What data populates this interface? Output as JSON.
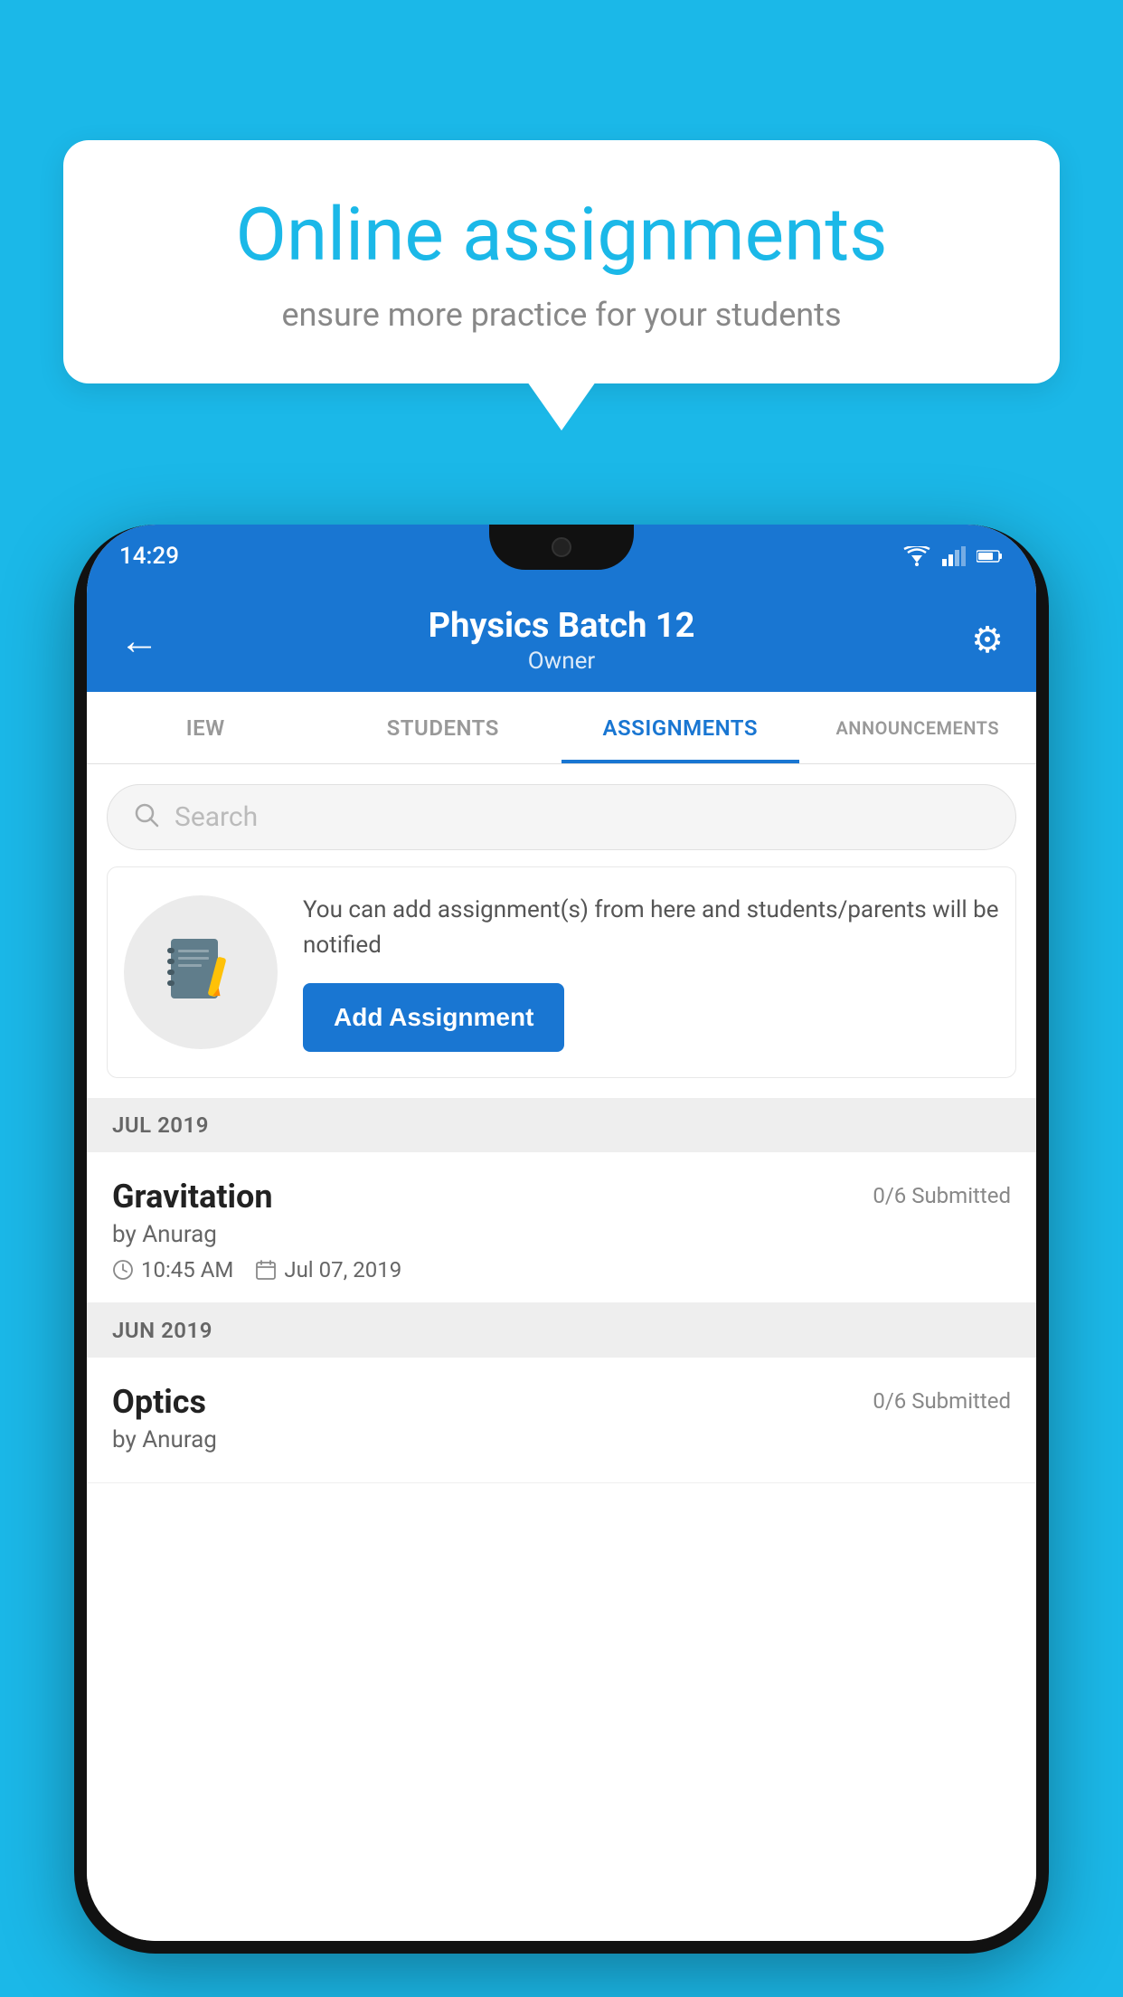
{
  "background_color": "#1BB8E8",
  "speech_bubble": {
    "title": "Online assignments",
    "subtitle": "ensure more practice for your students"
  },
  "phone": {
    "status_bar": {
      "time": "14:29"
    },
    "header": {
      "title": "Physics Batch 12",
      "subtitle": "Owner",
      "back_label": "←",
      "gear_label": "⚙"
    },
    "tabs": [
      {
        "label": "IEW",
        "active": false
      },
      {
        "label": "STUDENTS",
        "active": false
      },
      {
        "label": "ASSIGNMENTS",
        "active": true
      },
      {
        "label": "ANNOUNCEMENTS",
        "active": false
      }
    ],
    "search": {
      "placeholder": "Search"
    },
    "prompt_card": {
      "text": "You can add assignment(s) from here and students/parents will be notified",
      "button_label": "Add Assignment"
    },
    "sections": [
      {
        "label": "JUL 2019",
        "assignments": [
          {
            "name": "Gravitation",
            "submitted": "0/6 Submitted",
            "by": "by Anurag",
            "time": "10:45 AM",
            "date": "Jul 07, 2019"
          }
        ]
      },
      {
        "label": "JUN 2019",
        "assignments": [
          {
            "name": "Optics",
            "submitted": "0/6 Submitted",
            "by": "by Anurag",
            "time": "",
            "date": ""
          }
        ]
      }
    ]
  }
}
